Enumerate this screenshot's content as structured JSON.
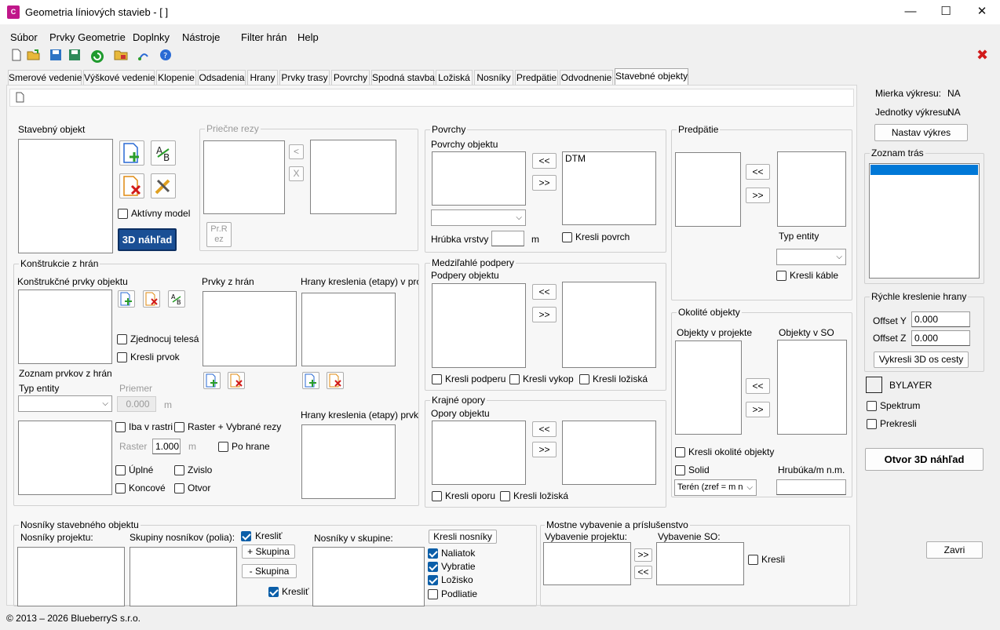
{
  "window": {
    "title": "Geometria líniových stavieb - [  ]",
    "app_icon": "C",
    "minimize": "—",
    "maximize": "☐",
    "close": "✕"
  },
  "menu": [
    "Súbor",
    "Prvky Geometrie",
    "Doplnky",
    "Nástroje",
    "Filter hrán",
    "Help"
  ],
  "toolbar_close": "✖",
  "tabs": [
    "Smerové vedenie",
    "Výškové vedenie",
    "Klopenie",
    "Odsadenia",
    "Hrany",
    "Prvky trasy",
    "Povrchy",
    "Spodná stavba",
    "Ložiská",
    "Nosníky",
    "Predpätie",
    "Odvodnenie",
    "Stavebné objekty"
  ],
  "stavebny": {
    "title": "Stavebný objekt",
    "aktivny": "Aktívny model",
    "nahlad": "3D náhľad"
  },
  "priecne": {
    "title": "Priečne rezy",
    "lt": "<",
    "x": "X",
    "prrez": "Pr.R\nez"
  },
  "povrchy": {
    "title": "Povrchy",
    "sub": "Povrchy objektu",
    "left": "<<",
    "right": ">>",
    "item": "DTM",
    "hrubka": "Hrúbka vrstvy",
    "unit": "m",
    "kresli": "Kresli povrch"
  },
  "medzi": {
    "title": "Medziľahlé podpery",
    "sub": "Podpery objektu",
    "left": "<<",
    "right": ">>",
    "c1": "Kresli podperu",
    "c2": "Kresli vykop",
    "c3": "Kresli ložiská"
  },
  "krajne": {
    "title": "Krajné opory",
    "sub": "Opory objektu",
    "left": "<<",
    "right": ">>",
    "c1": "Kresli oporu",
    "c2": "Kresli ložiská"
  },
  "predpatie": {
    "title": "Predpätie",
    "left": "<<",
    "right": ">>",
    "typ": "Typ entity",
    "kresli": "Kresli káble"
  },
  "okolite": {
    "title": "Okolité objekty",
    "sub1": "Objekty v projekte",
    "sub2": "Objekty v SO",
    "left": "<<",
    "right": ">>",
    "kresli": "Kresli okolité objekty",
    "solid": "Solid",
    "hrubka": "Hrubúka/m n.m.",
    "teren": "Terén (zref = m n"
  },
  "konstrukcie": {
    "title": "Konštrukcie z hrán",
    "prvky": "Konštrukčné prvky objektu",
    "zjednocuj": "Zjednocuj telesá",
    "kreslip": "Kresli prvok",
    "zoznam": "Zoznam prvkov z hrán",
    "typ": "Typ entity",
    "priemer": "Priemer",
    "priemer_val": "0.000",
    "m": "m",
    "prvkyhran": "Prvky z hrán",
    "hrany1": "Hrany kreslenia (etapy) v proje",
    "hrany2": "Hrany kreslenia (etapy) prvku",
    "iba": "Iba v rastri",
    "raster_vybrane": "Raster + Vybrané rezy",
    "raster": "Raster",
    "raster_val": "1.000",
    "pohrane": "Po hrane",
    "uplne": "Úplné",
    "zvislo": "Zvislo",
    "koncove": "Koncové",
    "otvor": "Otvor"
  },
  "nosniky": {
    "title": "Nosníky stavebného objektu",
    "projektu": "Nosníky projektu:",
    "skupiny": "Skupiny nosníkov (polia):",
    "kreslit": "Kresliť",
    "plus": "+ Skupina",
    "minus": "- Skupina",
    "kreslit2": "Kresliť",
    "vskupine": "Nosníky v skupine:",
    "kresli_nosniky": "Kresli nosníky",
    "naliatok": "Naliatok",
    "vybratie": "Vybratie",
    "lozisko": "Ložisko",
    "podliatie": "Podliatie"
  },
  "mostne": {
    "title": "Mostne vybavenie a príslušenstvo",
    "vp": "Vybavenie projektu:",
    "vso": "Vybavenie SO:",
    "right": ">>",
    "left": "<<",
    "kresli": "Kresli"
  },
  "side": {
    "mierka_l": "Mierka výkresu:",
    "mierka_v": "NA",
    "jednotky_l": "Jednotky výkresu:",
    "jednotky_v": "NA",
    "nastav": "Nastav výkres",
    "zoznam": "Zoznam trás",
    "rychle": "Rýchle kreslenie hrany",
    "offy": "Offset Y",
    "offy_v": "0.000",
    "offz": "Offset Z",
    "offz_v": "0.000",
    "vykresli": "Vykresli 3D os cesty",
    "bylayer": "BYLAYER",
    "spektrum": "Spektrum",
    "prekresli": "Prekresli",
    "otvor": "Otvor 3D náhľad",
    "zavri": "Zavri"
  },
  "status": "© 2013 – 2026 BlueberryS s.r.o.",
  "colors": {
    "accent": "#0b5ea8",
    "nahlad_bg": "#1a4f95",
    "selection": "#0078d7",
    "close_red": "#d11a1a"
  }
}
